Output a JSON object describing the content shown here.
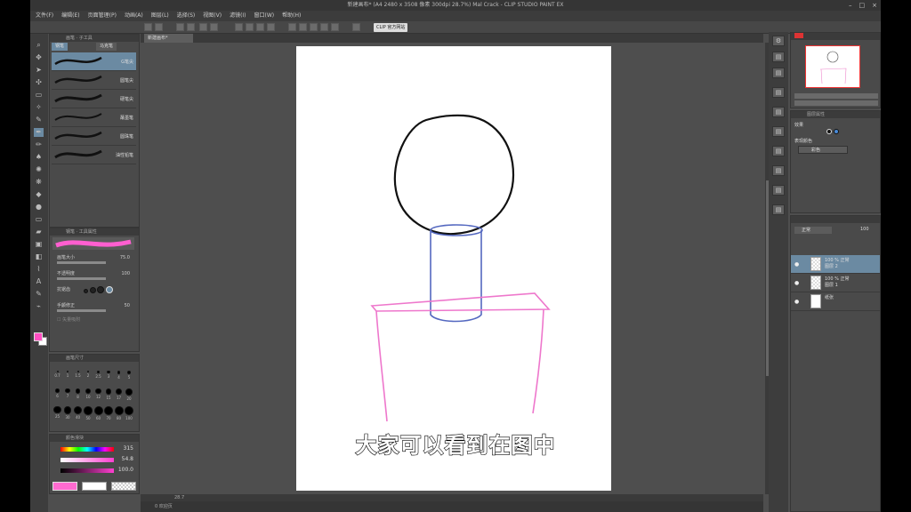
{
  "window": {
    "title": "新建画布* (A4 2480 x 3508 像素 300dpi 28.7%)   Mal Crack - CLIP STUDIO PAINT EX",
    "controls": [
      "–",
      "□",
      "×"
    ]
  },
  "menu": [
    "文件(F)",
    "编辑(E)",
    "页面管理(P)",
    "动画(A)",
    "图层(L)",
    "选择(S)",
    "视图(V)",
    "滤镜(I)",
    "窗口(W)",
    "帮助(H)"
  ],
  "command_bar": {
    "clip_button": "CLIP 官方网站"
  },
  "document_tab": {
    "label": "新建画布*"
  },
  "brush_panel": {
    "header": "画笔 · 子工具",
    "tabs": [
      "钢笔",
      "马克笔"
    ],
    "brushes": [
      "G笔尖",
      "圆笔尖",
      "硬笔尖",
      "蘸墨笔",
      "圆珠笔",
      "油性铅笔"
    ],
    "selected_index": 0
  },
  "tool_property": {
    "header": "钢笔 · 工具属性",
    "rows": [
      {
        "label": "画笔大小",
        "value": "75.0"
      },
      {
        "label": "不透明度",
        "value": "100"
      },
      {
        "label": "抗锯齿",
        "value": ""
      },
      {
        "label": "手颤修正",
        "value": "50"
      }
    ],
    "checkbox_label": "矢量吸附"
  },
  "brush_size_panel": {
    "header": "画笔尺寸",
    "sizes": [
      "0.7",
      "1",
      "1.5",
      "2",
      "2.5",
      "3",
      "4",
      "5",
      "6",
      "7",
      "8",
      "10",
      "12",
      "15",
      "17",
      "20",
      "25",
      "30",
      "40",
      "50",
      "60",
      "70",
      "80",
      "100"
    ]
  },
  "color_panel": {
    "header": "颜色滑块",
    "h": "315",
    "s": "54.8",
    "v": "100.0",
    "main_color": "#ff6ad0"
  },
  "navigator": {
    "zoom": "28.7",
    "rotation": "0.0"
  },
  "layer_property": {
    "header": "图层属性",
    "label_effect": "效果",
    "label_color": "表现颜色",
    "color_value": "彩色"
  },
  "layers_panel": {
    "blend_mode": "正常",
    "opacity": "100",
    "layers": [
      {
        "line1": "100 % 正常",
        "line2": "图层 2",
        "selected": true,
        "thumb": "checker"
      },
      {
        "line1": "100 % 正常",
        "line2": "图层 1",
        "selected": false,
        "thumb": "checker"
      },
      {
        "line1": "",
        "line2": "纸张",
        "selected": false,
        "thumb": "white"
      }
    ]
  },
  "status": {
    "text": "28.7",
    "bottom_label": "0 欢迎页"
  },
  "subtitle": "大家可以看到在图中",
  "colors": {
    "pink_stroke": "#ee77cc",
    "blue_stroke": "#5468c0",
    "black_stroke": "#111111"
  }
}
